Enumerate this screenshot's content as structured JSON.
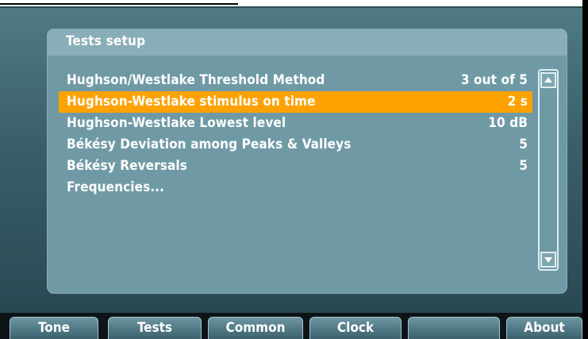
{
  "panel": {
    "title": "Tests setup",
    "rows": [
      {
        "label": "Hughson/Westlake Threshold Method",
        "value": "3 out of 5"
      },
      {
        "label": "Hughson-Westlake stimulus on time",
        "value": "2 s",
        "selected": true
      },
      {
        "label": "Hughson-Westlake Lowest level",
        "value": "10 dB"
      },
      {
        "label": "Békésy Deviation among Peaks & Valleys",
        "value": "5"
      },
      {
        "label": "Békésy Reversals",
        "value": "5"
      },
      {
        "label": "Frequencies...",
        "value": ""
      }
    ],
    "selected_color": "#ffa200"
  },
  "scrollbar": {
    "up_icon": "arrow-up-icon",
    "down_icon": "arrow-down-icon"
  },
  "function_keys": [
    {
      "label": "Tone"
    },
    {
      "label": "Tests"
    },
    {
      "label": "Common"
    },
    {
      "label": "Clock"
    },
    {
      "label": ""
    },
    {
      "label": "About"
    }
  ]
}
